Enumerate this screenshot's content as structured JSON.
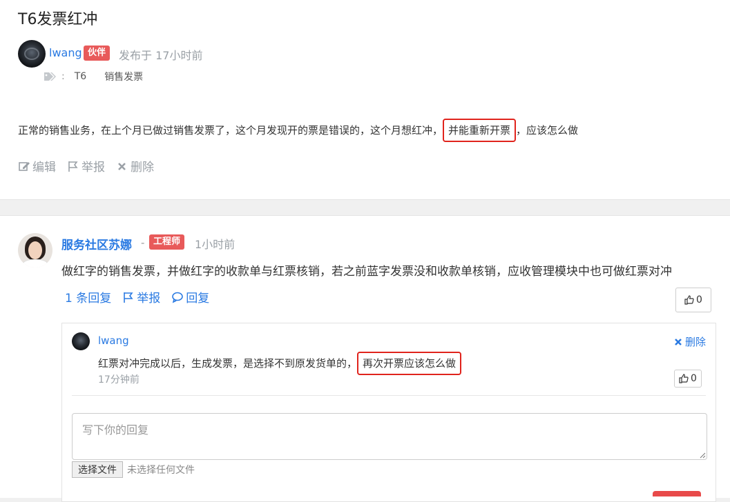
{
  "question": {
    "title": "T6发票红冲",
    "author": "lwang",
    "author_badge": "伙伴",
    "posted": "发布于 17小时前",
    "tags_colon": ":",
    "tags": [
      "T6",
      "销售发票"
    ],
    "body_before": "正常的销售业务，在上个月已做过销售发票了，这个月发现开的票是错误的，这个月想红冲，",
    "body_highlight": "并能重新开票",
    "body_after": "，应该怎么做",
    "actions": {
      "edit": "编辑",
      "report": "举报",
      "delete": "删除"
    }
  },
  "answer": {
    "author": "服务社区苏娜",
    "dash": "-",
    "badge": "工程师",
    "time": "1小时前",
    "body": "做红字的销售发票，并做红字的收款单与红票核销，若之前蓝字发票没和收款单核销，应收管理模块中也可做红票对冲",
    "actions": {
      "replies": "1 条回复",
      "report": "举报",
      "reply": "回复"
    },
    "likes": "0"
  },
  "reply": {
    "author": "lwang",
    "delete": "删除",
    "body_before": "红票对冲完成以后，生成发票，是选择不到原发货单的，",
    "body_highlight": "再次开票应该怎么做",
    "time": "17分钟前",
    "likes": "0"
  },
  "reply_form": {
    "placeholder": "写下你的回复",
    "file_button": "选择文件",
    "file_status": "未选择任何文件"
  },
  "colors": {
    "link": "#2a7ae2",
    "badge": "#e85a5a",
    "highlight_box": "#e0231c",
    "muted": "#9aa0a6"
  },
  "icons": [
    "tag-icon",
    "edit-icon",
    "flag-icon",
    "close-icon",
    "comment-icon",
    "thumbs-up-icon"
  ]
}
